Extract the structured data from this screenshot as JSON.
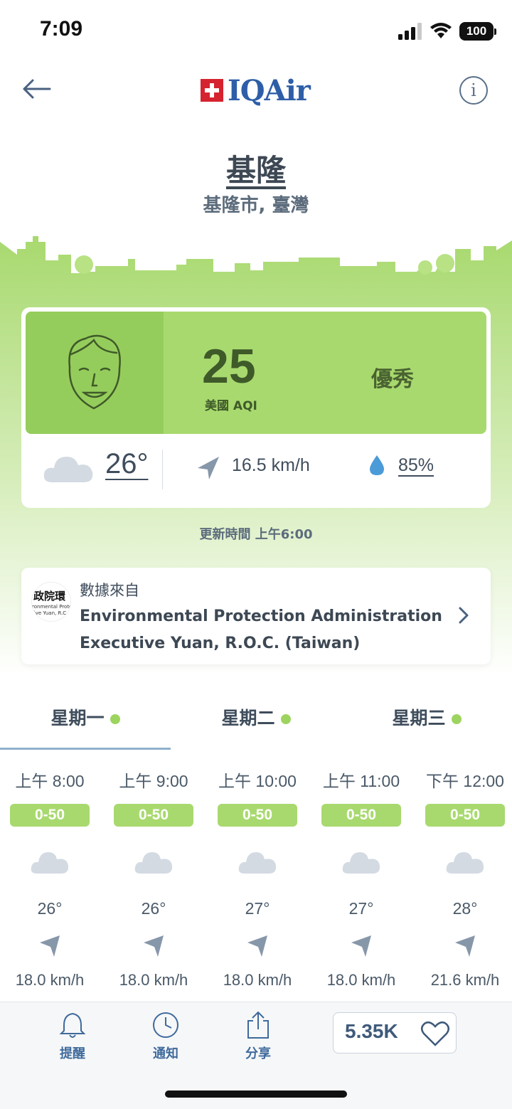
{
  "status_bar": {
    "time": "7:09",
    "battery": "100"
  },
  "header": {
    "brand": "IQAir"
  },
  "location": {
    "city": "基隆",
    "region": "基隆市, 臺灣"
  },
  "aqi": {
    "value": "25",
    "unit": "美國 AQI",
    "label": "優秀",
    "color": "#a8d96e"
  },
  "weather": {
    "temperature": "26°",
    "wind": "16.5 km/h",
    "humidity": "85%"
  },
  "updated": "更新時間 上午6:00",
  "source": {
    "title": "數據來自",
    "name_line1": "Environmental Protection Administration",
    "name_line2": "Executive Yuan, R.O.C. (Taiwan)",
    "logo_text": "政院環",
    "logo_sub1": "ronmental Protec",
    "logo_sub2": "tive Yuan, R.C"
  },
  "days": [
    {
      "label": "星期一",
      "active": true
    },
    {
      "label": "星期二",
      "active": false
    },
    {
      "label": "星期三",
      "active": false
    }
  ],
  "hourly": [
    {
      "time": "上午 8:00",
      "aqi": "0-50",
      "temp": "26°",
      "wind": "18.0 km/h"
    },
    {
      "time": "上午 9:00",
      "aqi": "0-50",
      "temp": "26°",
      "wind": "18.0 km/h"
    },
    {
      "time": "上午 10:00",
      "aqi": "0-50",
      "temp": "27°",
      "wind": "18.0 km/h"
    },
    {
      "time": "上午 11:00",
      "aqi": "0-50",
      "temp": "27°",
      "wind": "18.0 km/h"
    },
    {
      "time": "下午 12:00",
      "aqi": "0-50",
      "temp": "28°",
      "wind": "21.6 km/h"
    }
  ],
  "bottom_bar": {
    "reminder": "提醒",
    "notifications": "通知",
    "share": "分享",
    "likes": "5.35K"
  },
  "icons": [
    "back-arrow-icon",
    "info-icon",
    "face-icon",
    "cloud-icon",
    "wind-direction-icon",
    "humidity-drop-icon",
    "chevron-right-icon",
    "bell-icon",
    "clock-icon",
    "share-icon",
    "heart-icon"
  ]
}
